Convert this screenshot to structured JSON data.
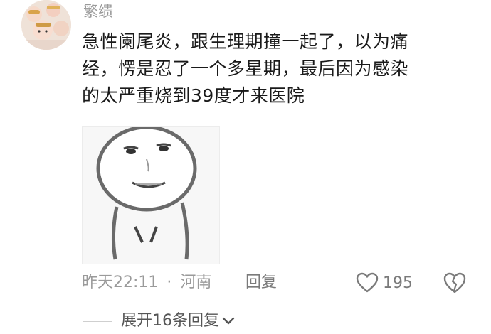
{
  "comment": {
    "username": "繁缋",
    "text_lines": [
      "急性阑尾炎，跟生理期撞一起了，以为痛",
      "经，愣是忍了一个多星期，最后因为感染",
      "的太严重烧到39度才来医院"
    ],
    "time": "昨天22:11",
    "separator": "·",
    "location": "河南",
    "reply_label": "回复",
    "like_count": "195",
    "expand_label": "展开16条回复"
  },
  "icons": {
    "like": "heart-outline-icon",
    "dislike": "broken-heart-icon",
    "expand": "chevron-down-icon"
  },
  "colors": {
    "text": "#1a1a1a",
    "muted": "#9a9a9a",
    "action": "#7a7a7a"
  }
}
